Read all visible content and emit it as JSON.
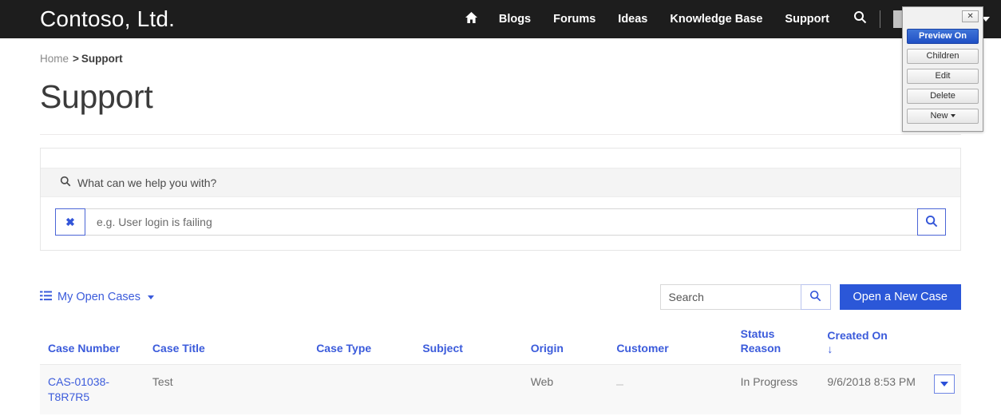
{
  "nav": {
    "brand": "Contoso, Ltd.",
    "home_icon": "home-icon",
    "links": [
      "Blogs",
      "Forums",
      "Ideas",
      "Knowledge Base",
      "Support"
    ],
    "search_icon": "search-icon",
    "user_menu_redacted": ""
  },
  "breadcrumb": {
    "home": "Home",
    "separator": ">",
    "current": "Support"
  },
  "page": {
    "title": "Support"
  },
  "search_panel": {
    "heading": "What can we help you with?",
    "heading_icon": "search-icon",
    "clear_label": "✖",
    "input_value": "",
    "input_placeholder": "e.g. User login is failing",
    "submit_icon": "search-icon"
  },
  "toolbar": {
    "view_icon": "list-icon",
    "view_label": "My Open Cases",
    "search_value": "",
    "search_placeholder": "Search",
    "search_button_icon": "search-icon",
    "new_case_label": "Open a New Case"
  },
  "table": {
    "columns": [
      "Case Number",
      "Case Title",
      "Case Type",
      "Subject",
      "Origin",
      "Customer",
      "Status Reason",
      "Created On"
    ],
    "sorted_column": "Created On",
    "sort_direction": "↓",
    "rows": [
      {
        "case_number": "CAS-01038-T8R7R5",
        "case_title": "Test",
        "case_type": "",
        "subject": "",
        "origin": "Web",
        "customer": "",
        "status_reason": "In Progress",
        "created_on": "9/6/2018 8:53 PM",
        "row_menu_icon": "chevron-down-icon"
      }
    ]
  },
  "edit_panel": {
    "close_label": "✕",
    "buttons": [
      "Preview On",
      "Children",
      "Edit",
      "Delete",
      "New"
    ]
  },
  "colors": {
    "nav_background": "#1d1d1d",
    "accent_blue": "#3b5bdb",
    "primary_button": "#2b57d8",
    "panel_header": "#f4f4f4",
    "row_background": "#f8f8f8"
  }
}
